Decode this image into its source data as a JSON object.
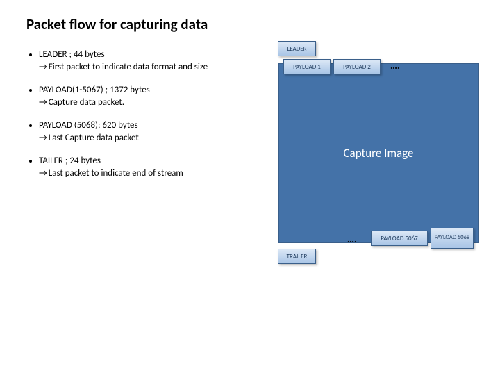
{
  "title": "Packet flow for capturing data",
  "bullets": [
    {
      "head": "LEADER ; 44 bytes",
      "sub": "First packet to indicate data format and size"
    },
    {
      "head": "PAYLOAD(1-5067) ; 1372 bytes",
      "sub": "Capture data packet."
    },
    {
      "head": "PAYLOAD (5068); 620 bytes",
      "sub": "Last Capture data packet"
    },
    {
      "head": "TAILER ; 24 bytes",
      "sub": "Last packet to indicate end of stream"
    }
  ],
  "diagram": {
    "capture_label": "Capture Image",
    "leader": "LEADER",
    "payload1": "PAYLOAD 1",
    "payload2": "PAYLOAD 2",
    "dots_top": "….",
    "dots_bot": "….",
    "payload5067": "PAYLOAD 5067",
    "payload5068": "PAYLOAD 5068",
    "trailer": "TRAILER"
  }
}
